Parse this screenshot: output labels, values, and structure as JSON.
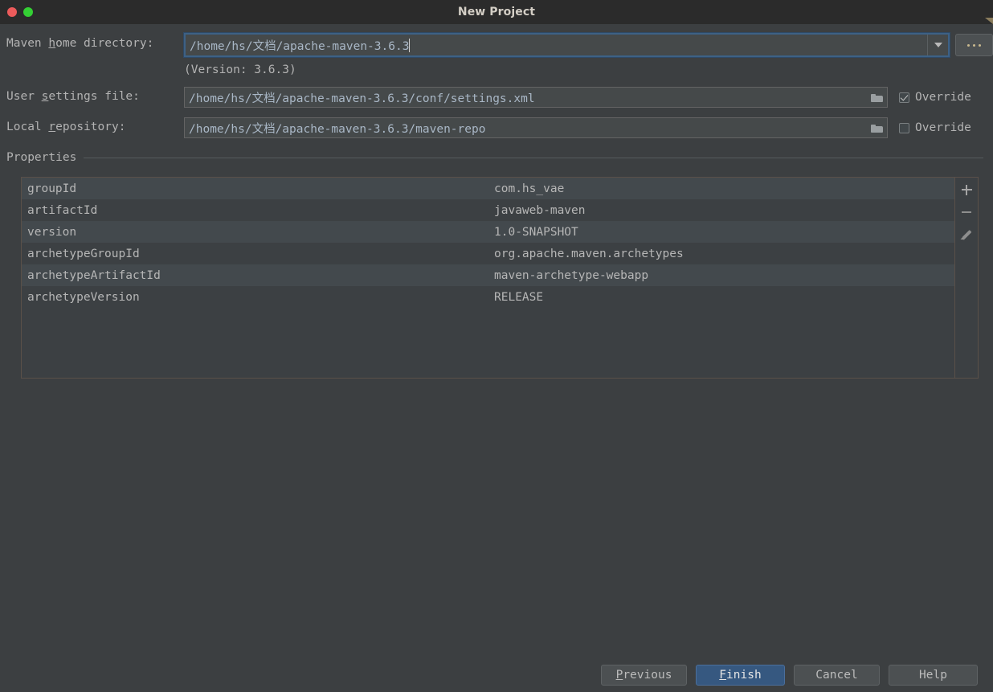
{
  "window": {
    "title": "New Project",
    "controls": [
      {
        "name": "close",
        "color": "#ec5b5b"
      },
      {
        "name": "maximize",
        "color": "#34cf34"
      }
    ]
  },
  "form": {
    "maven_home": {
      "label_prefix": "Maven ",
      "label_mnemonic": "h",
      "label_suffix": "ome directory:",
      "value": "/home/hs/文档/apache-maven-3.6.3",
      "version_note": "(Version: 3.6.3)",
      "browse_button": "...",
      "dropdown_icon": "chevron-down-icon"
    },
    "user_settings": {
      "label_prefix": "User ",
      "label_mnemonic": "s",
      "label_suffix": "ettings file:",
      "value": "/home/hs/文档/apache-maven-3.6.3/conf/settings.xml",
      "folder_icon": "folder-icon",
      "override_label": "Override",
      "override_checked": true
    },
    "local_repository": {
      "label_prefix": "Local ",
      "label_mnemonic": "r",
      "label_suffix": "epository:",
      "value": "/home/hs/文档/apache-maven-3.6.3/maven-repo",
      "folder_icon": "folder-icon",
      "override_label": "Override",
      "override_checked": false
    }
  },
  "properties": {
    "section_title": "Properties",
    "rows": [
      {
        "key": "groupId",
        "value": "com.hs_vae"
      },
      {
        "key": "artifactId",
        "value": "javaweb-maven"
      },
      {
        "key": "version",
        "value": "1.0-SNAPSHOT"
      },
      {
        "key": "archetypeGroupId",
        "value": "org.apache.maven.archetypes"
      },
      {
        "key": "archetypeArtifactId",
        "value": "maven-archetype-webapp"
      },
      {
        "key": "archetypeVersion",
        "value": "RELEASE"
      }
    ],
    "toolbar": [
      {
        "name": "add",
        "icon": "plus-icon"
      },
      {
        "name": "remove",
        "icon": "minus-icon"
      },
      {
        "name": "edit",
        "icon": "pencil-icon"
      }
    ]
  },
  "footer": {
    "previous": {
      "prefix": "",
      "mnemonic": "P",
      "suffix": "revious"
    },
    "finish": {
      "prefix": "",
      "mnemonic": "F",
      "suffix": "inish"
    },
    "cancel": {
      "label": "Cancel"
    },
    "help": {
      "label": "Help"
    }
  },
  "colors": {
    "dialog_bg": "#3c3f41",
    "titlebar_bg": "#2b2b2b",
    "field_bg": "#45494a",
    "focus_border": "#3d6185",
    "default_button": "#365880",
    "text": "#b3b3b3",
    "value_text": "#a9b7c6",
    "table_row_odd": "#43494d",
    "table_row_even": "#3c4043"
  }
}
